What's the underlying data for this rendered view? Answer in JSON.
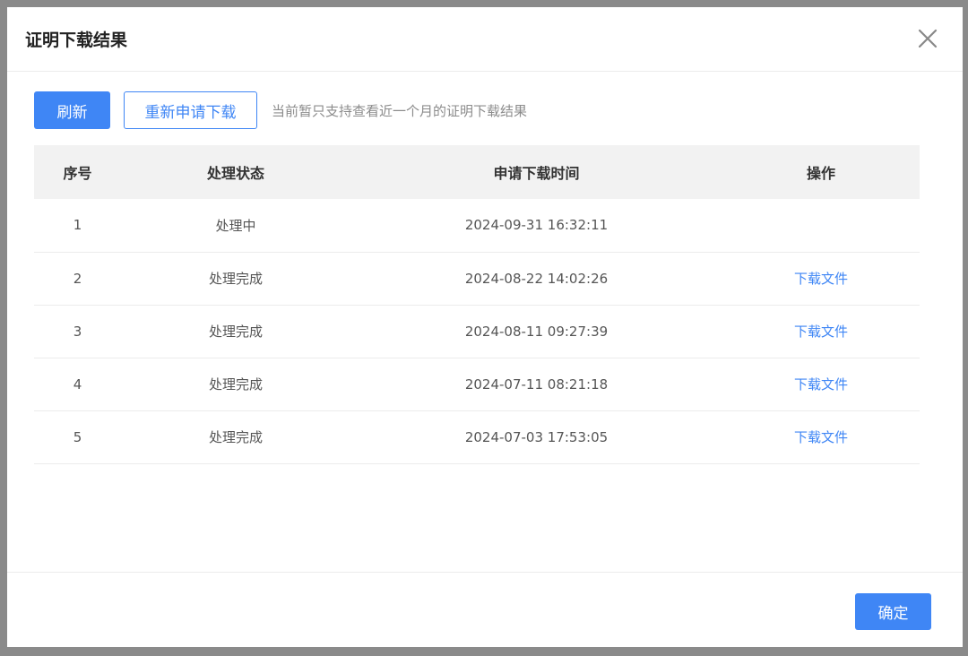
{
  "dialog": {
    "title": "证明下载结果",
    "close_icon": "close-icon"
  },
  "toolbar": {
    "refresh_label": "刷新",
    "reapply_label": "重新申请下载",
    "hint": "当前暂只支持查看近一个月的证明下载结果"
  },
  "table": {
    "headers": [
      "序号",
      "处理状态",
      "申请下载时间",
      "操作"
    ],
    "rows": [
      {
        "index": "1",
        "status": "处理中",
        "time": "2024-09-31 16:32:11",
        "action": ""
      },
      {
        "index": "2",
        "status": "处理完成",
        "time": "2024-08-22 14:02:26",
        "action": "下载文件"
      },
      {
        "index": "3",
        "status": "处理完成",
        "time": "2024-08-11 09:27:39",
        "action": "下载文件"
      },
      {
        "index": "4",
        "status": "处理完成",
        "time": "2024-07-11 08:21:18",
        "action": "下载文件"
      },
      {
        "index": "5",
        "status": "处理完成",
        "time": "2024-07-03 17:53:05",
        "action": "下载文件"
      }
    ]
  },
  "footer": {
    "ok_label": "确定"
  },
  "colors": {
    "accent": "#3f86f5",
    "header_bg": "#f2f2f2"
  }
}
